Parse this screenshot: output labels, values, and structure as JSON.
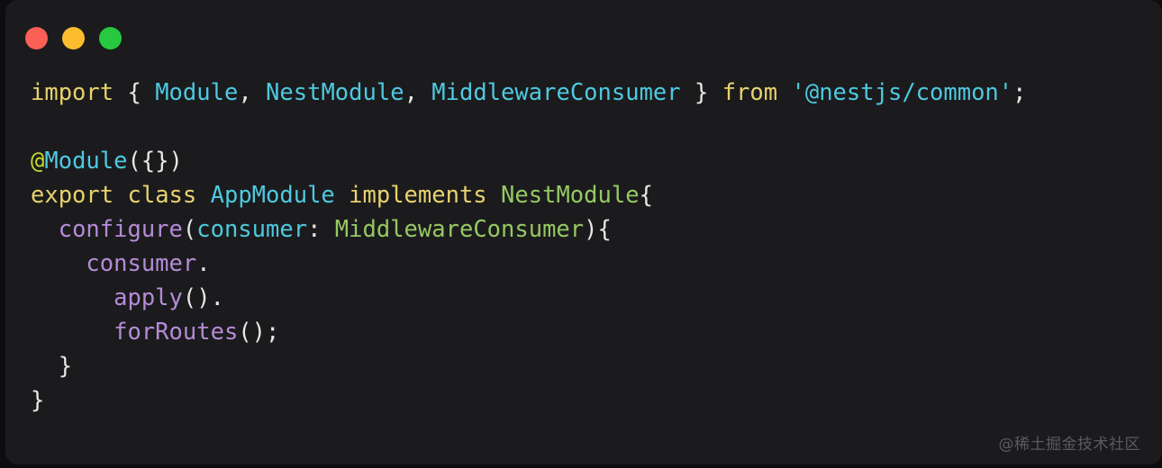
{
  "window": {
    "background_color": "#1b1b1d",
    "page_background_color": "#0d0d0f",
    "titlebar": {
      "buttons": [
        {
          "name": "close",
          "label": "",
          "color": "#fb5f56"
        },
        {
          "name": "minimize",
          "label": "",
          "color": "#fbbd2e"
        },
        {
          "name": "maximize",
          "label": "",
          "color": "#26c93f"
        }
      ]
    }
  },
  "code": {
    "language": "typescript",
    "plain_text": "import { Module, NestModule, MiddlewareConsumer } from '@nestjs/common';\n\n@Module({})\nexport class AppModule implements NestModule{\n  configure(consumer: MiddlewareConsumer){\n    consumer.\n      apply().\n      forRoutes();\n  }\n}",
    "lines": [
      {
        "n": 1,
        "text": "import { Module, NestModule, MiddlewareConsumer } from '@nestjs/common';",
        "tokens": [
          {
            "t": "import",
            "c": "keyword"
          },
          {
            "t": " ",
            "c": "plain"
          },
          {
            "t": "{",
            "c": "punct"
          },
          {
            "t": " ",
            "c": "plain"
          },
          {
            "t": "Module",
            "c": "type"
          },
          {
            "t": ",",
            "c": "punct"
          },
          {
            "t": " ",
            "c": "plain"
          },
          {
            "t": "NestModule",
            "c": "type"
          },
          {
            "t": ",",
            "c": "punct"
          },
          {
            "t": " ",
            "c": "plain"
          },
          {
            "t": "MiddlewareConsumer",
            "c": "type"
          },
          {
            "t": " ",
            "c": "plain"
          },
          {
            "t": "}",
            "c": "punct"
          },
          {
            "t": " ",
            "c": "plain"
          },
          {
            "t": "from",
            "c": "keyword"
          },
          {
            "t": " ",
            "c": "plain"
          },
          {
            "t": "'@nestjs/common'",
            "c": "string"
          },
          {
            "t": ";",
            "c": "punct"
          }
        ]
      },
      {
        "n": 2,
        "text": "",
        "tokens": []
      },
      {
        "n": 3,
        "text": "@Module({})",
        "tokens": [
          {
            "t": "@",
            "c": "at"
          },
          {
            "t": "Module",
            "c": "type"
          },
          {
            "t": "({})",
            "c": "punct"
          }
        ]
      },
      {
        "n": 4,
        "text": "export class AppModule implements NestModule{",
        "tokens": [
          {
            "t": "export",
            "c": "keyword"
          },
          {
            "t": " ",
            "c": "plain"
          },
          {
            "t": "class",
            "c": "keyword"
          },
          {
            "t": " ",
            "c": "plain"
          },
          {
            "t": "AppModule",
            "c": "type"
          },
          {
            "t": " ",
            "c": "plain"
          },
          {
            "t": "implements",
            "c": "keyword"
          },
          {
            "t": " ",
            "c": "plain"
          },
          {
            "t": "NestModule",
            "c": "green"
          },
          {
            "t": "{",
            "c": "punct"
          }
        ]
      },
      {
        "n": 5,
        "text": "  configure(consumer: MiddlewareConsumer){",
        "tokens": [
          {
            "t": "  ",
            "c": "plain"
          },
          {
            "t": "configure",
            "c": "fn"
          },
          {
            "t": "(",
            "c": "punct"
          },
          {
            "t": "consumer",
            "c": "var"
          },
          {
            "t": ":",
            "c": "punct"
          },
          {
            "t": " ",
            "c": "plain"
          },
          {
            "t": "MiddlewareConsumer",
            "c": "green"
          },
          {
            "t": "){",
            "c": "punct"
          }
        ]
      },
      {
        "n": 6,
        "text": "    consumer.",
        "tokens": [
          {
            "t": "    ",
            "c": "plain"
          },
          {
            "t": "consumer",
            "c": "fn"
          },
          {
            "t": ".",
            "c": "punct"
          }
        ]
      },
      {
        "n": 7,
        "text": "      apply().",
        "tokens": [
          {
            "t": "      ",
            "c": "plain"
          },
          {
            "t": "apply",
            "c": "fn"
          },
          {
            "t": "().",
            "c": "punct"
          }
        ]
      },
      {
        "n": 8,
        "text": "      forRoutes();",
        "tokens": [
          {
            "t": "      ",
            "c": "plain"
          },
          {
            "t": "forRoutes",
            "c": "fn"
          },
          {
            "t": "();",
            "c": "punct"
          }
        ]
      },
      {
        "n": 9,
        "text": "  }",
        "tokens": [
          {
            "t": "  ",
            "c": "plain"
          },
          {
            "t": "}",
            "c": "punct"
          }
        ]
      },
      {
        "n": 10,
        "text": "}",
        "tokens": [
          {
            "t": "}",
            "c": "punct"
          }
        ]
      }
    ],
    "theme_colors": {
      "keyword": "#e8d26d",
      "type": "#4ec9e0",
      "green": "#96c864",
      "at": "#c3d82c",
      "function": "#b58bd6",
      "variable": "#4ec9e0",
      "string": "#4ec9e0",
      "punctuation": "#e6e6e6",
      "background": "#1b1b1d"
    }
  },
  "watermark": {
    "text": "@稀土掘金技术社区"
  }
}
